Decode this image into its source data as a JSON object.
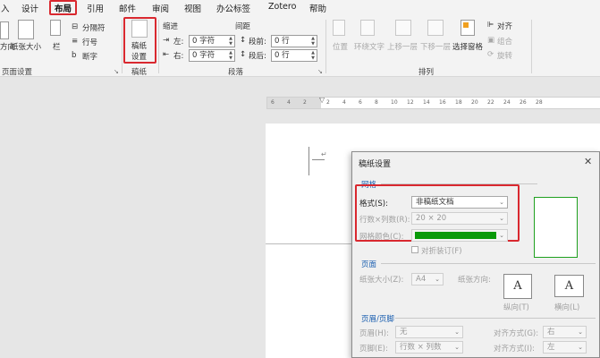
{
  "tabs": [
    {
      "label": "入"
    },
    {
      "label": "设计"
    },
    {
      "label": "布局"
    },
    {
      "label": "引用"
    },
    {
      "label": "邮件"
    },
    {
      "label": "审阅"
    },
    {
      "label": "视图"
    },
    {
      "label": "办公标签"
    },
    {
      "label": "Zotero"
    },
    {
      "label": "帮助"
    }
  ],
  "ribbon": {
    "page_setup": {
      "direction_label": "方向",
      "size_label": "纸张大小",
      "columns_label": "栏",
      "breaks_label": "分隔符",
      "line_numbers_label": "行号",
      "hyphenation_label": "断字",
      "group_label": "页面设置"
    },
    "manuscript": {
      "button_label_1": "稿纸",
      "button_label_2": "设置",
      "group_label": "稿纸"
    },
    "paragraph": {
      "indent_heading": "缩进",
      "spacing_heading": "间距",
      "left_label": "左:",
      "right_label": "右:",
      "before_label": "段前:",
      "after_label": "段后:",
      "left_value": "0 字符",
      "right_value": "0 字符",
      "before_value": "0 行",
      "after_value": "0 行",
      "group_label": "段落"
    },
    "arrange": {
      "position_label": "位置",
      "wrap_label": "环绕文字",
      "forward_label": "上移一层",
      "backward_label": "下移一层",
      "selection_pane_label": "选择窗格",
      "align_label": "对齐",
      "group_label": "组合",
      "rotate_label": "旋转",
      "group_name": "排列"
    }
  },
  "dialog": {
    "title": "稿纸设置",
    "grid_section": "网格",
    "format_label": "格式(S):",
    "format_value": "非稿纸文档",
    "rows_cols_label": "行数×列数(R):",
    "rows_cols_value": "20 × 20",
    "grid_color_label": "网格颜色(C):",
    "grid_color": "#0a9a0a",
    "fold_checkbox_label": "对折装订(F)",
    "page_section": "页面",
    "paper_size_label": "纸张大小(Z):",
    "paper_size_value": "A4",
    "orientation_label": "纸张方向:",
    "portrait_label": "纵向(T)",
    "landscape_label": "横向(L)",
    "header_footer_section": "页眉/页脚",
    "header_label": "页眉(H):",
    "header_value": "无",
    "header_align_label": "对齐方式(G):",
    "header_align_value": "右",
    "footer_label": "页脚(E):",
    "footer_value": "行数 × 列数",
    "footer_align_label": "对齐方式(I):",
    "footer_align_value": "左"
  },
  "ruler": {
    "marks": [
      "6",
      "4",
      "2",
      "2",
      "4",
      "6",
      "8",
      "10",
      "12",
      "14",
      "16",
      "18",
      "20",
      "22",
      "24",
      "26",
      "28"
    ]
  },
  "colors": {
    "accent": "#1b5fb0",
    "highlight": "#d9282f"
  }
}
